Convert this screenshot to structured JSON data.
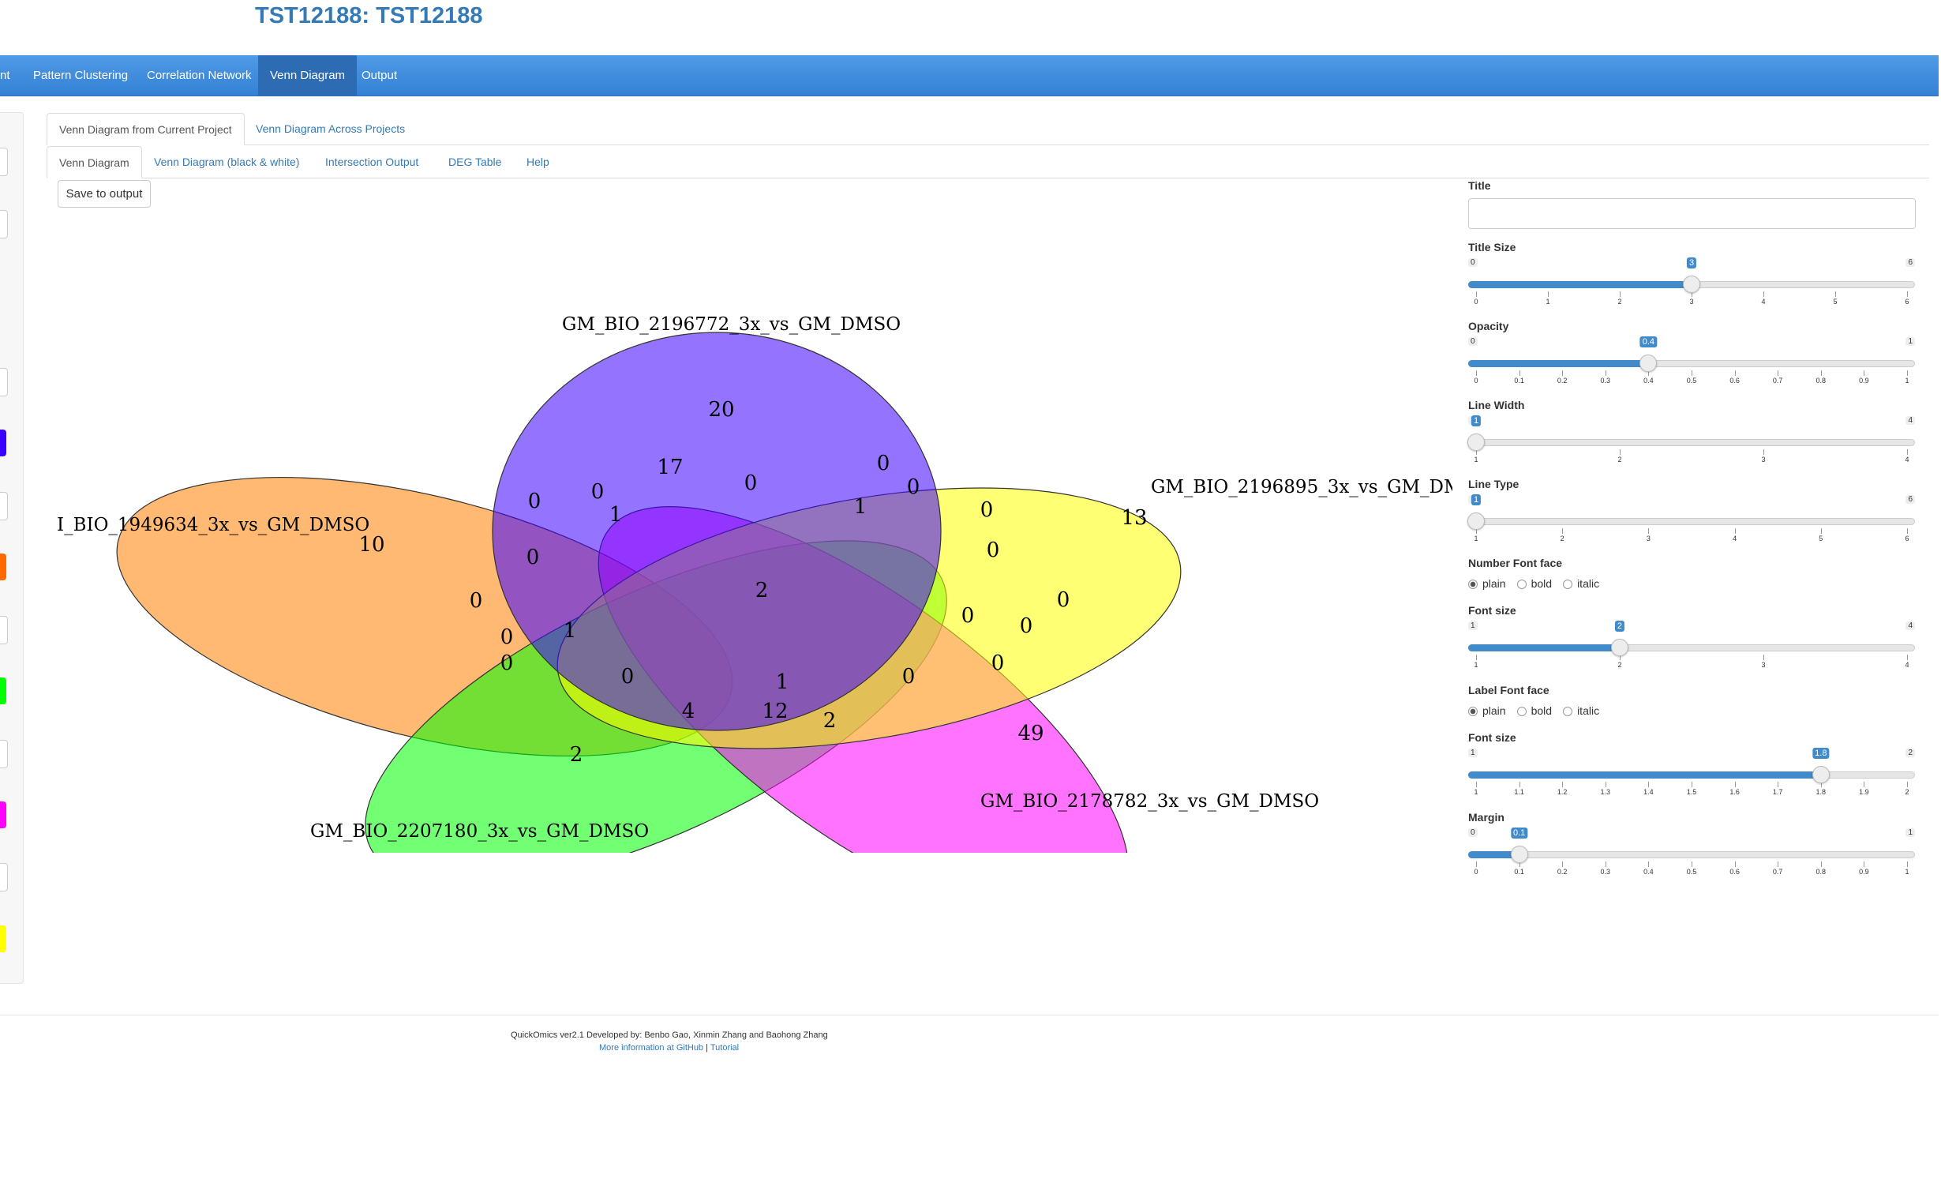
{
  "header": {
    "title": "TST12188: TST12188"
  },
  "navbar": {
    "items": [
      {
        "label": "nt",
        "active": false
      },
      {
        "label": "Pattern Clustering",
        "active": false
      },
      {
        "label": "Correlation Network",
        "active": false
      },
      {
        "label": "Venn Diagram",
        "active": true
      },
      {
        "label": "Output",
        "active": false
      }
    ]
  },
  "left_panel": {
    "color_swatches": [
      "#3a00ff",
      "#ff6a00",
      "#00ff00",
      "#ff00ff",
      "#ffff00"
    ]
  },
  "main_tabs": [
    {
      "label": "Venn Diagram from Current Project",
      "active": true
    },
    {
      "label": "Venn Diagram Across Projects",
      "active": false
    }
  ],
  "sub_tabs": [
    {
      "label": "Venn Diagram",
      "active": true
    },
    {
      "label": "Venn Diagram (black & white)",
      "active": false
    },
    {
      "label": "Intersection Output",
      "active": false
    },
    {
      "label": "DEG Table",
      "active": false
    },
    {
      "label": "Help",
      "active": false
    }
  ],
  "save_button": "Save to output",
  "venn": {
    "set_labels": [
      "GM_BIO_2196772_3x_vs_GM_DMSO",
      "GM_BIO_2196895_3x_vs_GM_DM",
      "GM_BIO_2178782_3x_vs_GM_DMSO",
      "GM_BIO_2207180_3x_vs_GM_DMSO",
      "I_BIO_1949634_3x_vs_GM_DMSO"
    ],
    "set_colors": [
      "#3a00ff",
      "#ffff00",
      "#ff00ff",
      "#00ff00",
      "#ff7f00"
    ],
    "region_counts": [
      "20",
      "17",
      "0",
      "0",
      "0",
      "13",
      "0",
      "0",
      "1",
      "1",
      "0",
      "0",
      "10",
      "0",
      "2",
      "0",
      "0",
      "0",
      "0",
      "1",
      "0",
      "0",
      "0",
      "0",
      "1",
      "12",
      "0",
      "4",
      "2",
      "2",
      "49"
    ]
  },
  "controls": {
    "title": {
      "label": "Title",
      "value": ""
    },
    "title_size": {
      "label": "Title Size",
      "min": "0",
      "max": "6",
      "value": "3",
      "fraction": 0.5,
      "ticks": [
        "0",
        "1",
        "2",
        "3",
        "4",
        "5",
        "6"
      ]
    },
    "opacity": {
      "label": "Opacity",
      "min": "0",
      "max": "1",
      "value": "0.4",
      "fraction": 0.4,
      "ticks": [
        "0",
        "0.1",
        "0.2",
        "0.3",
        "0.4",
        "0.5",
        "0.6",
        "0.7",
        "0.8",
        "0.9",
        "1"
      ]
    },
    "line_width": {
      "label": "Line Width",
      "min": "1",
      "max": "4",
      "value": "1",
      "fraction": 0,
      "ticks": [
        "1",
        "2",
        "3",
        "4"
      ]
    },
    "line_type": {
      "label": "Line Type",
      "min": "1",
      "max": "6",
      "value": "1",
      "fraction": 0,
      "ticks": [
        "1",
        "2",
        "3",
        "4",
        "5",
        "6"
      ]
    },
    "number_font_face": {
      "label": "Number Font face",
      "options": [
        "plain",
        "bold",
        "italic"
      ],
      "selected": "plain"
    },
    "number_font_size": {
      "label": "Font size",
      "min": "1",
      "max": "4",
      "value": "2",
      "fraction": 0.3333,
      "ticks": [
        "1",
        "2",
        "3",
        "4"
      ]
    },
    "label_font_face": {
      "label": "Label Font face",
      "options": [
        "plain",
        "bold",
        "italic"
      ],
      "selected": "plain"
    },
    "label_font_size": {
      "label": "Font size",
      "min": "1",
      "max": "2",
      "value": "1.8",
      "fraction": 0.8,
      "ticks": [
        "1",
        "1.1",
        "1.2",
        "1.3",
        "1.4",
        "1.5",
        "1.6",
        "1.7",
        "1.8",
        "1.9",
        "2"
      ]
    },
    "margin": {
      "label": "Margin",
      "min": "0",
      "max": "1",
      "value": "0.1",
      "fraction": 0.1,
      "ticks": [
        "0",
        "0.1",
        "0.2",
        "0.3",
        "0.4",
        "0.5",
        "0.6",
        "0.7",
        "0.8",
        "0.9",
        "1"
      ]
    }
  },
  "footer": {
    "credit": "QuickOmics ver2.1 Developed by: Benbo Gao, Xinmin Zhang and Baohong Zhang",
    "link_github": "More information at GitHub",
    "separator": "|",
    "link_tutorial": "Tutorial"
  }
}
